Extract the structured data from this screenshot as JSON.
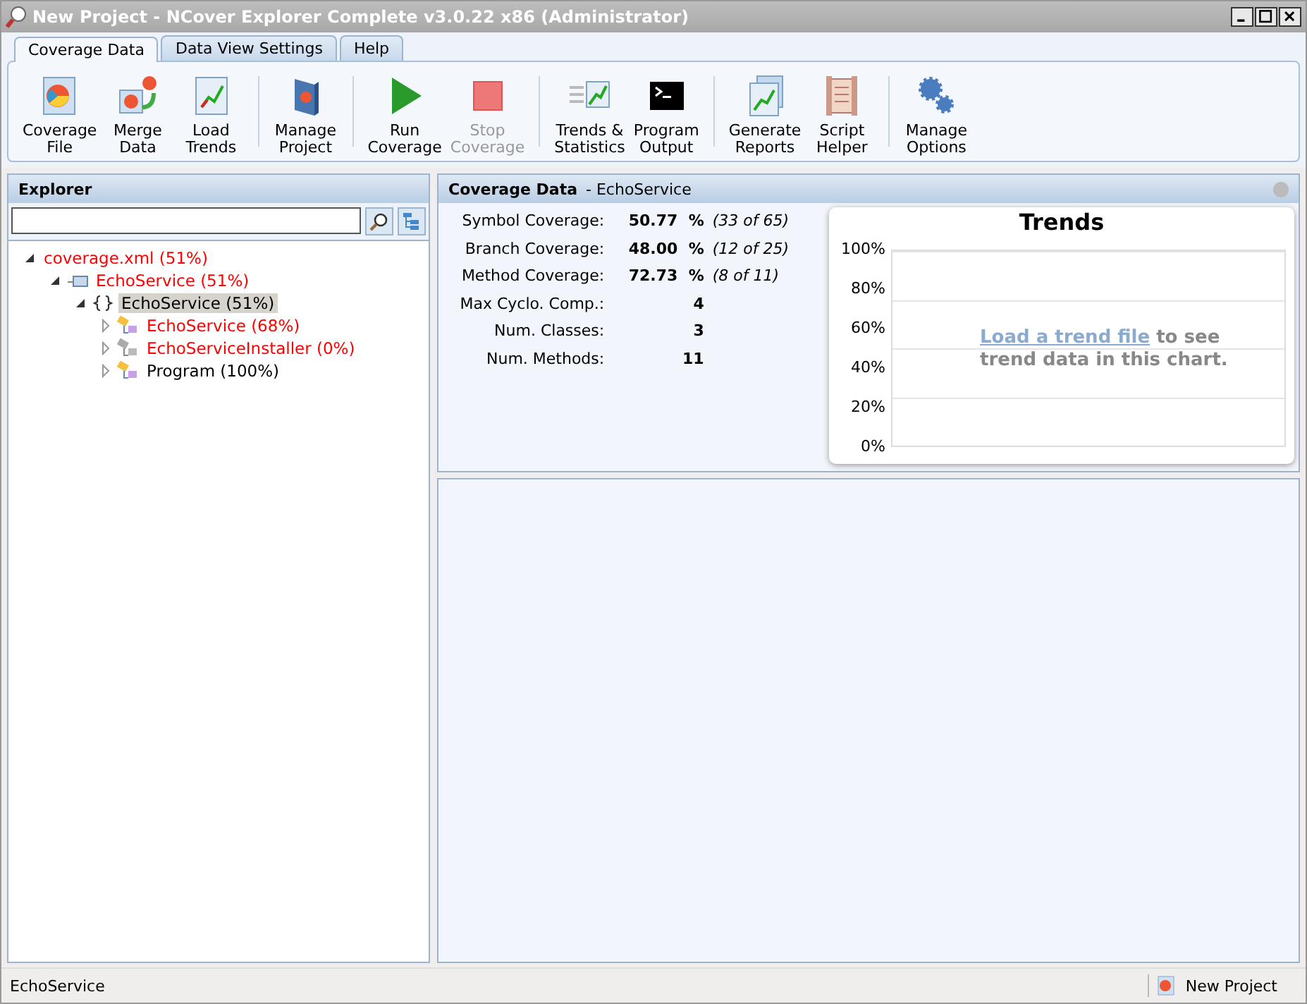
{
  "window": {
    "title": "New Project - NCover Explorer Complete v3.0.22 x86 (Administrator)"
  },
  "tabs": [
    {
      "label": "Coverage Data",
      "selected": true
    },
    {
      "label": "Data View Settings",
      "selected": false
    },
    {
      "label": "Help",
      "selected": false
    }
  ],
  "toolbar_groups": [
    [
      {
        "kind": "coverage-file",
        "lines": [
          "Coverage",
          "File"
        ],
        "disabled": false
      },
      {
        "kind": "merge",
        "lines": [
          "Merge",
          "Data"
        ],
        "disabled": false
      },
      {
        "kind": "trends",
        "lines": [
          "Load",
          "Trends"
        ],
        "disabled": false
      }
    ],
    [
      {
        "kind": "project",
        "lines": [
          "Manage",
          "Project"
        ],
        "disabled": false
      }
    ],
    [
      {
        "kind": "run",
        "lines": [
          "Run",
          "Coverage"
        ],
        "disabled": false
      },
      {
        "kind": "stop",
        "lines": [
          "Stop",
          "Coverage"
        ],
        "disabled": true
      }
    ],
    [
      {
        "kind": "stats",
        "lines": [
          "Trends &",
          "Statistics"
        ],
        "disabled": false
      },
      {
        "kind": "console",
        "lines": [
          "Program",
          "Output"
        ],
        "disabled": false
      }
    ],
    [
      {
        "kind": "reports",
        "lines": [
          "Generate",
          "Reports"
        ],
        "disabled": false
      },
      {
        "kind": "scroll",
        "lines": [
          "Script",
          "Helper"
        ],
        "disabled": false
      }
    ],
    [
      {
        "kind": "gears",
        "lines": [
          "Manage",
          "Options"
        ],
        "disabled": false
      }
    ]
  ],
  "explorer": {
    "title": "Explorer",
    "tree": [
      {
        "label": "coverage.xml (51%)",
        "color": "#ff0000",
        "expanded": true,
        "selected": false,
        "children": [
          {
            "label": "EchoService (51%)",
            "kind": "assembly",
            "color": "#ff0000",
            "expanded": true,
            "selected": false,
            "children": [
              {
                "label": "EchoService (51%)",
                "kind": "namespace",
                "color": "#000000",
                "expanded": true,
                "selected": true,
                "children": [
                  {
                    "label": "EchoService (68%)",
                    "kind": "class",
                    "color": "#ff0000",
                    "expanded": false,
                    "selected": false
                  },
                  {
                    "label": "EchoServiceInstaller (0%)",
                    "kind": "class-grey",
                    "color": "#ff0000",
                    "expanded": false,
                    "selected": false
                  },
                  {
                    "label": "Program (100%)",
                    "kind": "class",
                    "color": "#000000",
                    "expanded": false,
                    "selected": false
                  }
                ]
              }
            ]
          }
        ]
      }
    ]
  },
  "coverage": {
    "title": "Coverage Data",
    "subtitle": "- EchoService",
    "stats": [
      {
        "label": "Symbol Coverage:",
        "value": "50.77",
        "unit": "%",
        "detail": "(33 of 65)"
      },
      {
        "label": "Branch Coverage:",
        "value": "48.00",
        "unit": "%",
        "detail": "(12 of 25)"
      },
      {
        "label": "Method Coverage:",
        "value": "72.73",
        "unit": "%",
        "detail": "(8 of 11)"
      },
      {
        "label": "Max Cyclo. Comp.:",
        "value": "4"
      },
      {
        "label": "Num. Classes:",
        "value": "3"
      },
      {
        "label": "Num. Methods:",
        "value": "11"
      }
    ],
    "trends": {
      "title": "Trends",
      "y_labels": [
        "100%",
        "80%",
        "60%",
        "40%",
        "20%",
        "0%"
      ],
      "link": "Load a trend file",
      "message": "to see trend data in this chart."
    }
  },
  "status_bar": {
    "left": "EchoService",
    "right": "New Project"
  }
}
